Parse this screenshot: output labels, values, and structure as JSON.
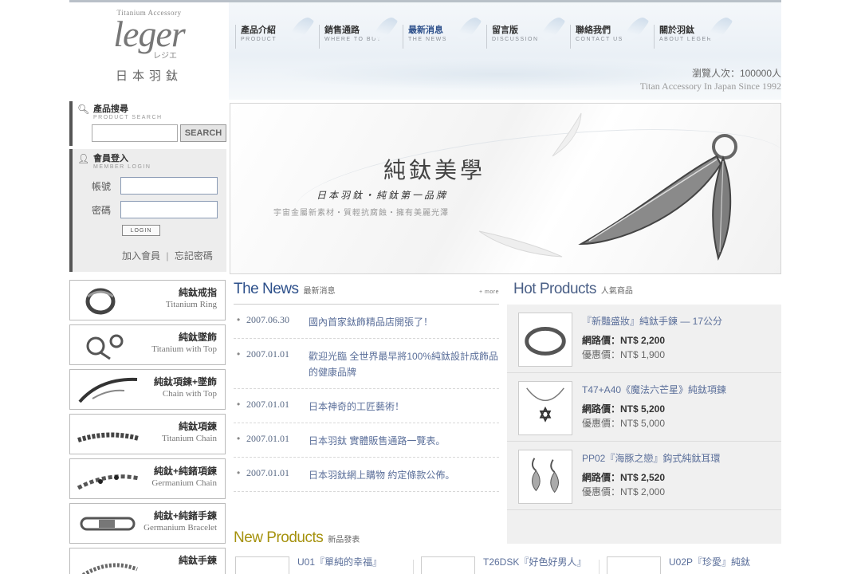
{
  "brand": {
    "tagline": "Titanium Accessory",
    "wordmark": "leger",
    "kana": "レジエ",
    "jp_name": "日本羽鈦"
  },
  "nav": [
    {
      "cn": "產品介紹",
      "en": "PRODUCT"
    },
    {
      "cn": "銷售通路",
      "en": "WHERE TO BUY"
    },
    {
      "cn": "最新消息",
      "en": "THE NEWS"
    },
    {
      "cn": "留言版",
      "en": "DISCUSSION"
    },
    {
      "cn": "聯絡我們",
      "en": "CONTACT US"
    },
    {
      "cn": "關於羽鈦",
      "en": "ABOUT LEGER"
    }
  ],
  "header": {
    "visitors": "瀏覽人次：100000人",
    "since": "Titan Accessory In Japan Since 1992"
  },
  "search": {
    "title_cn": "產品搜尋",
    "title_en": "PRODUCT SEARCH",
    "value": "",
    "button": "SEARCH"
  },
  "login": {
    "title_cn": "會員登入",
    "title_en": "MEMBER LOGIN",
    "account_label": "帳號",
    "password_label": "密碼",
    "button": "LOGIN",
    "join": "加入會員",
    "separator": "|",
    "forgot": "忘記密碼"
  },
  "categories": [
    {
      "cn": "純鈦戒指",
      "en": "Titanium Ring"
    },
    {
      "cn": "純鈦墜飾",
      "en": "Titanium with Top"
    },
    {
      "cn": "純鈦項鍊+墜飾",
      "en": "Chain with Top"
    },
    {
      "cn": "純鈦項鍊",
      "en": "Titanium Chain"
    },
    {
      "cn": "純鈦+純鍺項鍊",
      "en": "Germanium Chain"
    },
    {
      "cn": "純鈦+純鍺手鍊",
      "en": "Germanium Bracelet"
    },
    {
      "cn": "純鈦手鍊",
      "en": ""
    }
  ],
  "banner": {
    "title": "純鈦美學",
    "sub1": "日本羽鈦・純鈦第一品牌",
    "sub2": "宇宙金屬新素材・質輕抗腐蝕・擁有美麗光澤"
  },
  "news": {
    "title_en": "The News",
    "title_cn": "最新消息",
    "more": "+ more",
    "items": [
      {
        "date": "2007.06.30",
        "text": "國內首家鈦飾精品店開張了！"
      },
      {
        "date": "2007.01.01",
        "text": "歡迎光臨 全世界最早將100%純鈦設計成飾品的健康品牌"
      },
      {
        "date": "2007.01.01",
        "text": "日本神奇的工匠藝術！"
      },
      {
        "date": "2007.01.01",
        "text": "日本羽鈦 實體販售通路一覽表。"
      },
      {
        "date": "2007.01.01",
        "text": "日本羽鈦網上購物 約定條款公佈。"
      }
    ]
  },
  "hot": {
    "title_en": "Hot Products",
    "title_cn": "人氣商品",
    "items": [
      {
        "name": "『新豔盛妝』純鈦手鍊 — 17公分",
        "price": "網路價：NT$ 2,200",
        "sale": "優惠價：NT$ 1,900"
      },
      {
        "name": "T47+A40《魔法六芒星》純鈦項鍊",
        "price": "網路價：NT$ 5,200",
        "sale": "優惠價：NT$ 5,000"
      },
      {
        "name": "PP02『海豚之戀』鈎式純鈦耳環",
        "price": "網路價：NT$ 2,520",
        "sale": "優惠價：NT$ 2,000"
      }
    ]
  },
  "new_products": {
    "title_en": "New Products",
    "title_cn": "新品發表",
    "items": [
      {
        "name": "U01『單純的幸福』"
      },
      {
        "name": "T26DSK『好色好男人』"
      },
      {
        "name": "U02P『珍愛』純鈦"
      }
    ]
  }
}
